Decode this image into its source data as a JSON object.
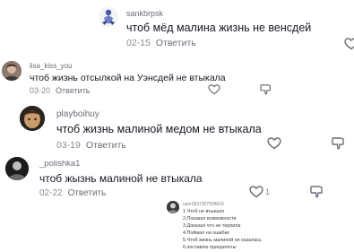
{
  "comments": [
    {
      "username": "sankbrpsk",
      "text": "чтоб мёд малина жизнь не венсдей",
      "date": "02-15",
      "reply_label": "Ответить",
      "like_icon": "heart-outline-icon",
      "dislike_icon": null
    },
    {
      "username": "lisa_kiss_you",
      "text": "чтоб жизнь отсылкой на Уэнсдей не втыкала",
      "date": "03-20",
      "reply_label": "Ответить",
      "like_icon": "heart-outline-icon",
      "dislike_icon": "thumbs-down-icon"
    },
    {
      "username": "playboihuy",
      "text": "чтоб жизнь малиной медом не втыкала",
      "date": "03-19",
      "reply_label": "Ответить",
      "like_icon": "heart-outline-icon",
      "dislike_icon": "thumbs-down-icon"
    },
    {
      "username": "_polishka1",
      "text": "чтоб жызнь малиной не втыкала",
      "date": "02-22",
      "reply_label": "Ответить",
      "like_count": "1",
      "like_icon": "heart-outline-icon",
      "dislike_icon": "thumbs-down-icon"
    }
  ],
  "sticker": {
    "username": "user3937307058615",
    "lines": [
      "1.Чтоб не втыкало",
      "2.Показал возможности",
      "3.Доказал что не терпила",
      "4.Поймал на ошибке",
      "5.Чтоб жизнь малиной не казалась",
      "6.поставлю приоритеты"
    ]
  }
}
